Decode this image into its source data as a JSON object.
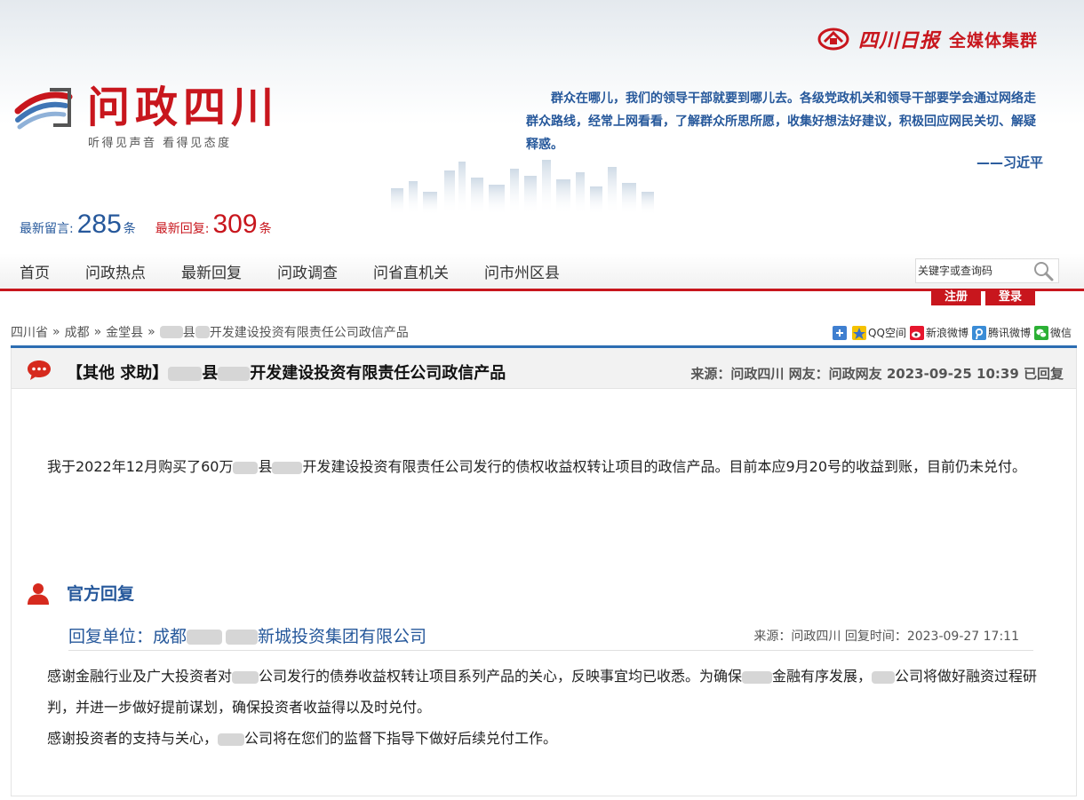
{
  "header": {
    "brand_script": "四川日报",
    "brand_text": "全媒体集群",
    "logo_title": "问政四川",
    "logo_slogan": "听得见声音  看得见态度",
    "quote": "群众在哪儿，我们的领导干部就要到哪儿去。各级党政机关和领导干部要学会通过网络走群众路线，经常上网看看，了解群众所思所愿，收集好想法好建议，积极回应网民关切、解疑释惑。",
    "quote_author": "——习近平"
  },
  "stats": {
    "new_msg_label": "最新留言:",
    "new_msg_count": "285",
    "new_msg_unit": "条",
    "new_reply_label": "最新回复:",
    "new_reply_count": "309",
    "new_reply_unit": "条"
  },
  "nav": {
    "items": [
      "首页",
      "问政热点",
      "最新回复",
      "问政调查",
      "问省直机关",
      "问市州区县"
    ],
    "search_placeholder": "关键字或查询码",
    "register": "注册",
    "login": "登录"
  },
  "breadcrumb": {
    "province": "四川省",
    "city": "成都",
    "county": "金堂县",
    "sep": "»",
    "current_part1": "县",
    "current_part2": "开发建设投资有限责任公司政信产品"
  },
  "share": {
    "items": [
      "QQ空间",
      "新浪微博",
      "腾讯微博",
      "微信"
    ]
  },
  "topic": {
    "title_prefix": "【其他 求助】",
    "title_part1": "县",
    "title_part2": "开发建设投资有限责任公司政信产品",
    "meta": "来源：问政四川 网友：问政网友  2023-09-25 10:39 已回复",
    "body_part1": "我于2022年12月购买了60万",
    "body_part2": "县",
    "body_part3": "开发建设投资有限责任公司发行的债权收益权转让项目的政信产品。目前本应9月20号的收益到账，目前仍未兑付。"
  },
  "reply": {
    "heading": "官方回复",
    "unit_label": "回复单位：成都",
    "unit_suffix": "新城投资集团有限公司",
    "meta": "来源：问政四川 回复时间：2023-09-27 17:11",
    "p1_a": "感谢金融行业及广大投资者对",
    "p1_b": "公司发行的债券收益权转让项目系列产品的关心，反映事宜均已收悉。为确保",
    "p1_c": "金融有序发展，",
    "p1_d": "公司将做好融资过程研判，并进一步做好提前谋划，确保投资者收益得以及时兑付。",
    "p2_a": "感谢投资者的支持与关心，",
    "p2_b": "公司将在您们的监督下指导下做好后续兑付工作。"
  },
  "colors": {
    "brand_red": "#c8161d",
    "brand_blue": "#26589b",
    "divider_blue": "#2c6db2"
  }
}
